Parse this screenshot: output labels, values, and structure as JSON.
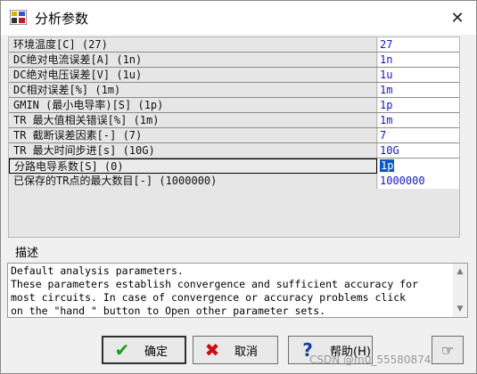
{
  "window": {
    "title": "分析参数"
  },
  "parameters": [
    {
      "name": "环境温度[C]  (27)",
      "value": "27"
    },
    {
      "name": "DC绝对电流误差[A]  (1n)",
      "value": "1n"
    },
    {
      "name": "DC绝对电压误差[V]  (1u)",
      "value": "1u"
    },
    {
      "name": "DC相对误差[%]  (1m)",
      "value": "1m"
    },
    {
      "name": "GMIN (最小电导率)[S]  (1p)",
      "value": "1p"
    },
    {
      "name": "TR 最大值相关错误[%]  (1m)",
      "value": "1m"
    },
    {
      "name": "TR 截断误差因素[-]  (7)",
      "value": "7"
    },
    {
      "name": "TR 最大时间步进[s]  (10G)",
      "value": "10G"
    },
    {
      "name": "分路电导系数[S]  (0)",
      "value": "1p"
    },
    {
      "name": "已保存的TR点的最大数目[-]  (1000000)",
      "value": "1000000"
    }
  ],
  "description": {
    "label": "描述",
    "text": "Default analysis parameters.\nThese parameters establish convergence and sufficient accuracy for\nmost circuits. In case of convergence or accuracy problems click\non the \"hand \" button to Open other parameter sets."
  },
  "buttons": {
    "ok": "确定",
    "cancel": "取消",
    "help": "帮助(H)"
  },
  "watermark": "CSDN @m0_55580874",
  "icons": {
    "app": "app-icon",
    "close": "close-icon",
    "ok": "checkmark-icon",
    "cancel": "x-icon",
    "help": "question-icon",
    "extra": "hand-icon"
  }
}
